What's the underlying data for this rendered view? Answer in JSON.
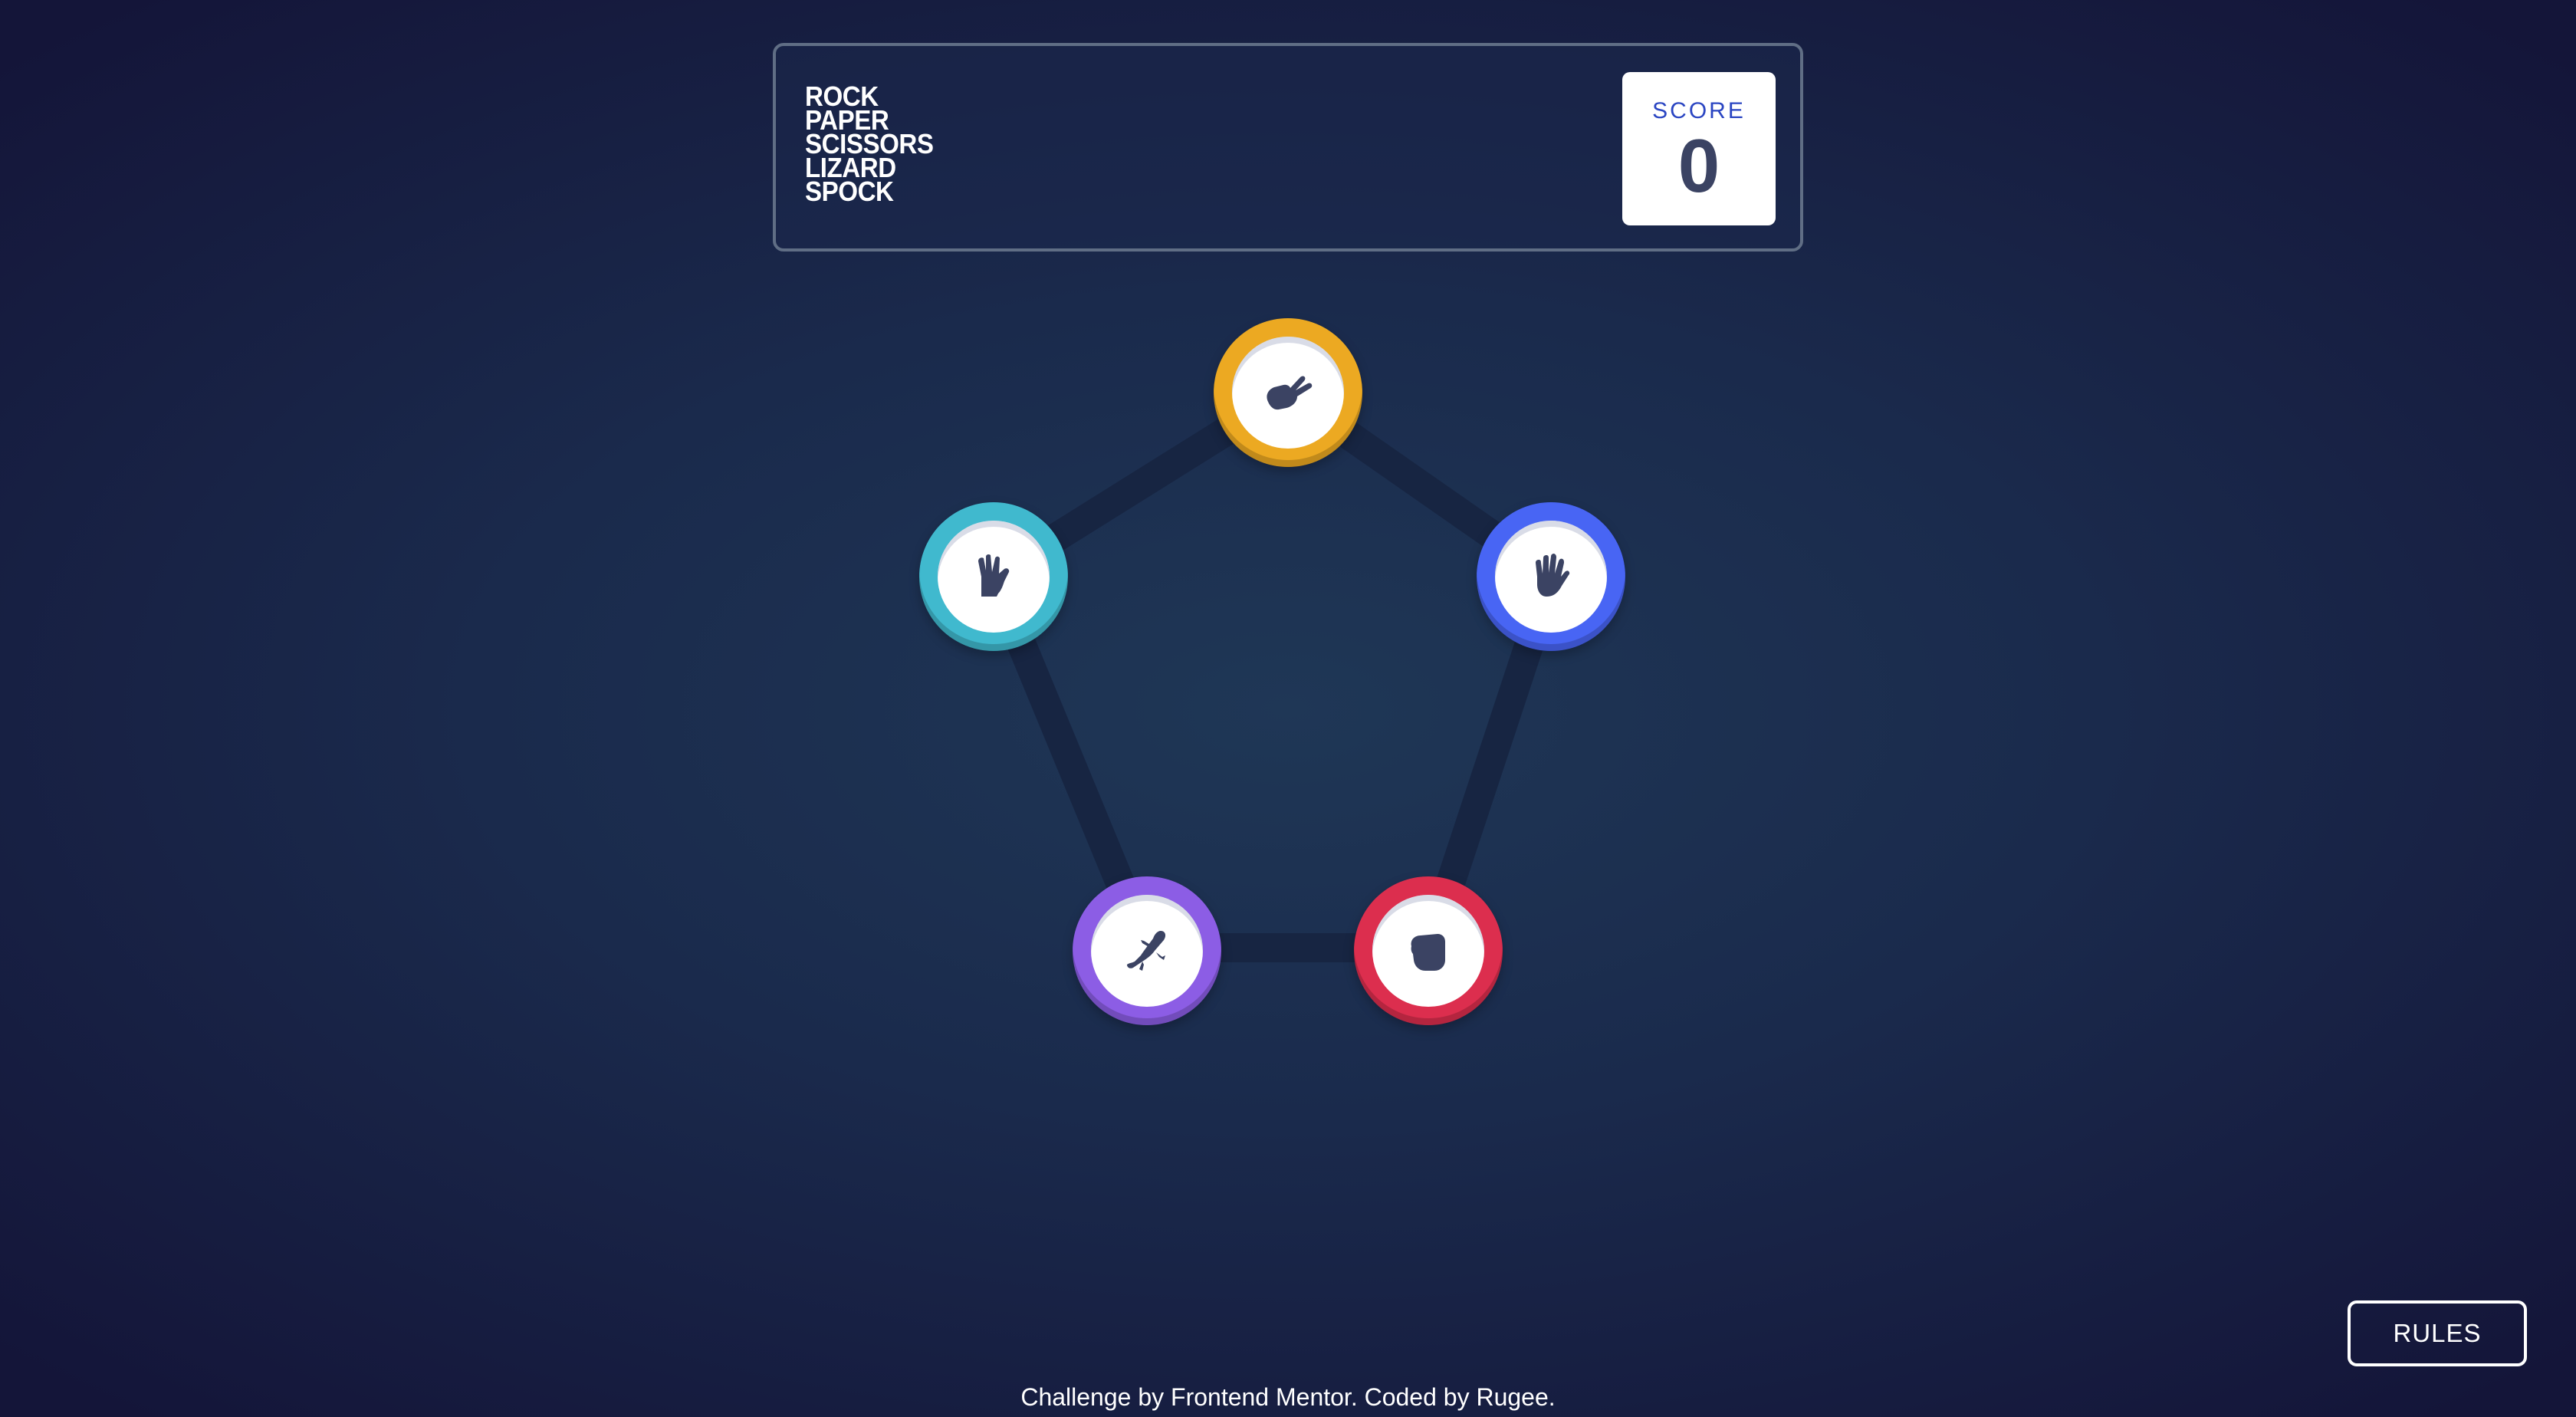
{
  "header": {
    "title_lines": [
      "ROCK",
      "PAPER",
      "SCISSORS",
      "LIZARD",
      "SPOCK"
    ],
    "score_label": "SCORE",
    "score_value": "0"
  },
  "choices": [
    {
      "id": "scissors",
      "icon": "scissors-hand-icon",
      "color": "#eca922"
    },
    {
      "id": "paper",
      "icon": "paper-hand-icon",
      "color": "#4865f4"
    },
    {
      "id": "rock",
      "icon": "rock-fist-icon",
      "color": "#dc2e4e"
    },
    {
      "id": "lizard",
      "icon": "lizard-icon",
      "color": "#8c5de5"
    },
    {
      "id": "spock",
      "icon": "spock-hand-icon",
      "color": "#40b9ce"
    }
  ],
  "rules_button": "RULES",
  "footer_text": "Challenge by Frontend Mentor. Coded by Rugee.",
  "colors": {
    "background_center": "#1f3756",
    "background_edge": "#141539",
    "score_label": "#2a45c2",
    "score_value": "#3b4363",
    "header_border": "#606e85"
  }
}
